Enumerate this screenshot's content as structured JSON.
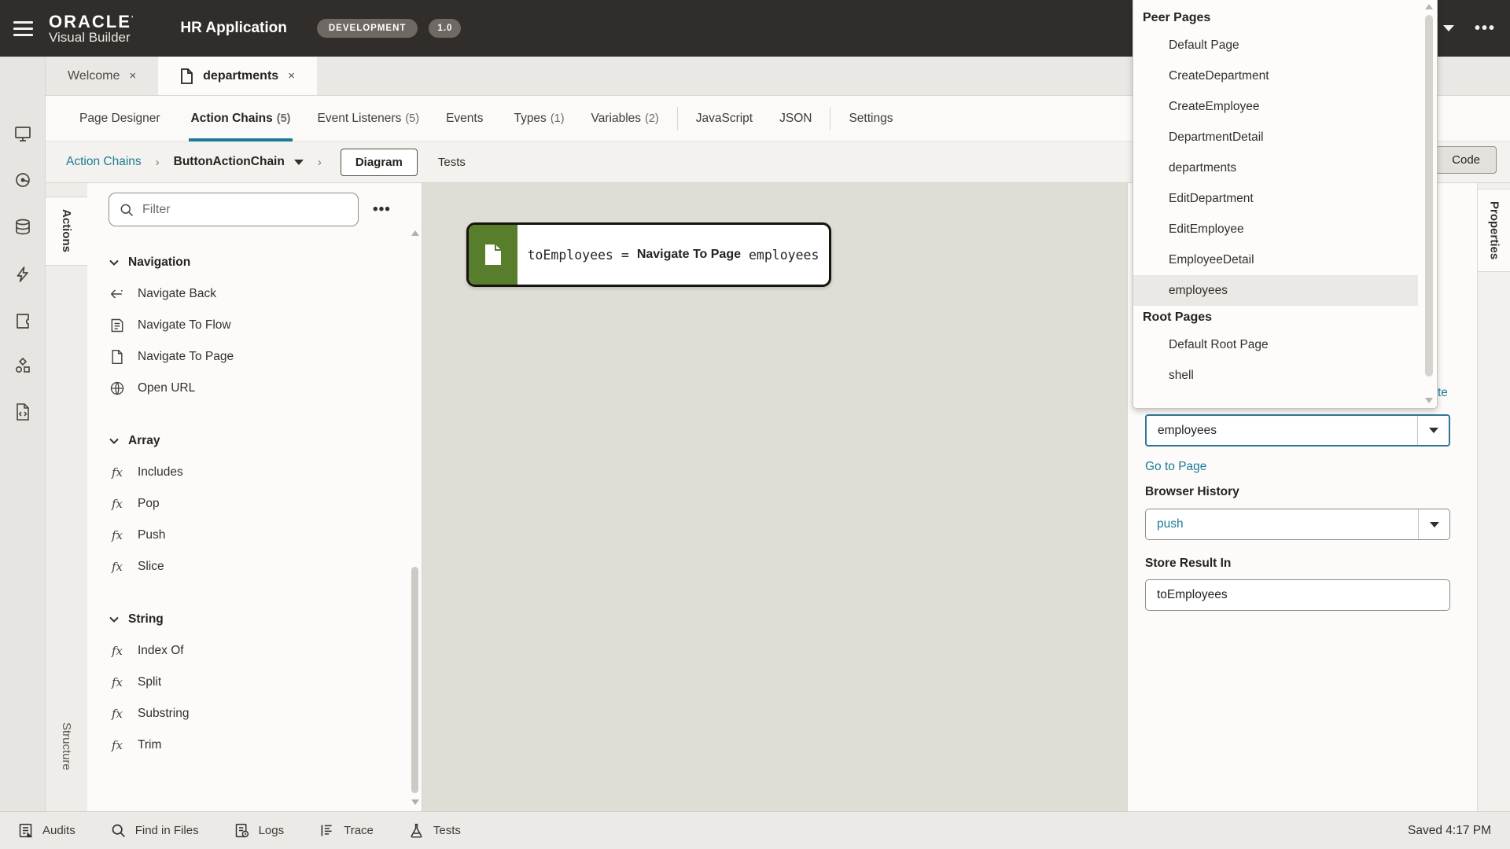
{
  "header": {
    "logo1": "ORACLE",
    "logo2": "Visual Builder",
    "title": "HR Application",
    "badge_env": "DEVELOPMENT",
    "badge_version": "1.0"
  },
  "window_tabs": {
    "welcome": "Welcome",
    "departments": "departments",
    "close": "×"
  },
  "doc_tabs": [
    {
      "label": "Page Designer",
      "count": ""
    },
    {
      "label": "Action Chains",
      "count": "(5)"
    },
    {
      "label": "Event Listeners",
      "count": "(5)"
    },
    {
      "label": "Events",
      "count": ""
    },
    {
      "label": "Types",
      "count": "(1)"
    },
    {
      "label": "Variables",
      "count": "(2)"
    },
    {
      "label": "JavaScript",
      "count": ""
    },
    {
      "label": "JSON",
      "count": ""
    },
    {
      "label": "Settings",
      "count": ""
    }
  ],
  "breadcrumb": {
    "root": "Action Chains",
    "sep": "›",
    "current": "ButtonActionChain"
  },
  "views": {
    "diagram": "Diagram",
    "tests": "Tests",
    "code": "Code"
  },
  "side_tabs": {
    "actions": "Actions",
    "structure": "Structure",
    "properties": "Properties"
  },
  "actions_panel": {
    "filter_placeholder": "Filter",
    "menu_dots": "•••",
    "sections": [
      {
        "title": "Navigation",
        "items": [
          {
            "label": "Navigate Back",
            "icon": "arrow-left-icon"
          },
          {
            "label": "Navigate To Flow",
            "icon": "flow-page-icon"
          },
          {
            "label": "Navigate To Page",
            "icon": "page-icon"
          },
          {
            "label": "Open URL",
            "icon": "globe-icon"
          }
        ]
      },
      {
        "title": "Array",
        "items": [
          {
            "label": "Includes",
            "icon": "fx-icon"
          },
          {
            "label": "Pop",
            "icon": "fx-icon"
          },
          {
            "label": "Push",
            "icon": "fx-icon"
          },
          {
            "label": "Slice",
            "icon": "fx-icon"
          }
        ]
      },
      {
        "title": "String",
        "items": [
          {
            "label": "Index Of",
            "icon": "fx-icon"
          },
          {
            "label": "Split",
            "icon": "fx-icon"
          },
          {
            "label": "Substring",
            "icon": "fx-icon"
          },
          {
            "label": "Trim",
            "icon": "fx-icon"
          }
        ]
      }
    ],
    "fx_glyph": "fx"
  },
  "canvas": {
    "node": {
      "result": "toEmployees",
      "operator": "=",
      "action": "Navigate To Page",
      "target": "employees"
    }
  },
  "page_dropdown": {
    "peer_header": "Peer Pages",
    "peer_items": [
      "Default Page",
      "CreateDepartment",
      "CreateEmployee",
      "DepartmentDetail",
      "departments",
      "EditDepartment",
      "EditEmployee",
      "EmployeeDetail",
      "employees"
    ],
    "root_header": "Root Pages",
    "root_items": [
      "Default Root Page",
      "shell"
    ],
    "selected": "employees"
  },
  "properties": {
    "create_link_fragment": "te",
    "page_value": "employees",
    "goto_link": "Go to Page",
    "history_label": "Browser History",
    "history_value": "push",
    "store_label": "Store Result In",
    "store_value": "toEmployees"
  },
  "rail_icons": [
    "screen-icon",
    "visual-icon",
    "database-icon",
    "lightning-icon",
    "component-icon",
    "shapes-icon",
    "code-file-icon"
  ],
  "status_bar": {
    "items": [
      "Audits",
      "Find in Files",
      "Logs",
      "Trace",
      "Tests"
    ],
    "saved": "Saved 4:17 PM"
  },
  "colors": {
    "header_bg": "#312d2a",
    "accent_teal": "#1c7b97",
    "node_green": "#587d2b",
    "canvas_bg": "#e0ddd7",
    "selection_bg": "#ebe9e5",
    "combo_focus_border": "#2d7795"
  }
}
